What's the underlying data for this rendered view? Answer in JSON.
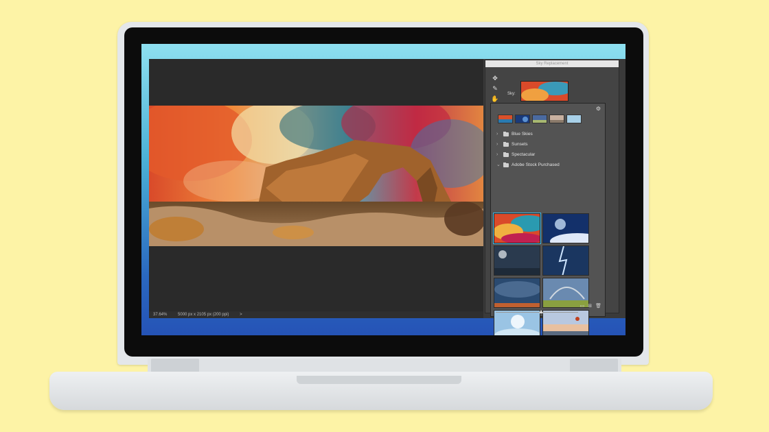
{
  "app": {
    "dialog_title": "Sky Replacement",
    "sky_label": "Sky:"
  },
  "tools": [
    {
      "icon": "move-icon"
    },
    {
      "icon": "sky-brush-icon"
    },
    {
      "icon": "hand-icon"
    }
  ],
  "popup": {
    "gear_icon": "gear-icon",
    "folders": [
      {
        "label": "Blue Skies",
        "expanded": false
      },
      {
        "label": "Sunsets",
        "expanded": false
      },
      {
        "label": "Spectacular",
        "expanded": false
      },
      {
        "label": "Adobe Stock Purchased",
        "expanded": true
      }
    ],
    "footer_icons": [
      "new-folder-icon",
      "add-sky-icon",
      "trash-icon"
    ],
    "thumb_size_level": 0.55
  },
  "statusbar": {
    "zoom": "37.64%",
    "doc_info": "5000 px x 2105 px (200 ppi)",
    "arrow": ">"
  },
  "colors": {
    "background": "#fdf3a6",
    "ps_canvas": "#2a2a2a",
    "panel": "#535353",
    "selection": "#3fb6e6"
  }
}
